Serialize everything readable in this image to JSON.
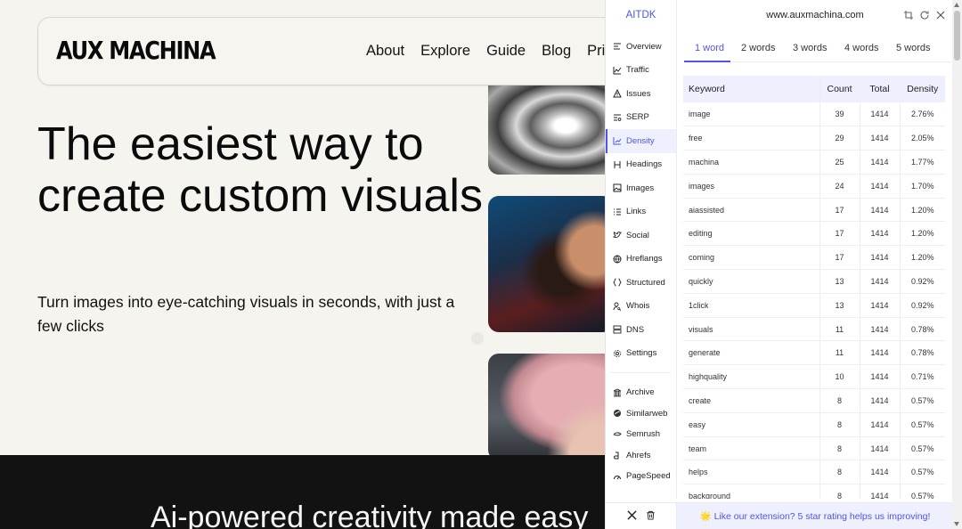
{
  "site": {
    "logo": "AUX MACHINA",
    "nav": [
      "About",
      "Explore",
      "Guide",
      "Blog",
      "Pricin"
    ],
    "hero_title": "The easiest way to create custom visuals",
    "hero_subtitle": "Turn images into eye-catching visuals in seconds, with just a few clicks",
    "band_text": "Ai-powered creativity made easy"
  },
  "extension": {
    "brand": "AITDK",
    "domain": "www.auxmachina.com",
    "accent": "#4f54e6",
    "sidebar": [
      {
        "label": "Overview",
        "icon": "overview-icon",
        "active": false
      },
      {
        "label": "Traffic",
        "icon": "traffic-icon",
        "active": false
      },
      {
        "label": "Issues",
        "icon": "warning-icon",
        "active": false
      },
      {
        "label": "SERP",
        "icon": "serp-icon",
        "active": false
      },
      {
        "label": "Density",
        "icon": "density-icon",
        "active": true
      },
      {
        "label": "Headings",
        "icon": "heading-icon",
        "active": false
      },
      {
        "label": "Images",
        "icon": "image-icon",
        "active": false
      },
      {
        "label": "Links",
        "icon": "links-icon",
        "active": false
      },
      {
        "label": "Social",
        "icon": "twitter-icon",
        "active": false
      },
      {
        "label": "Hreflangs",
        "icon": "globe-icon",
        "active": false
      },
      {
        "label": "Structured",
        "icon": "braces-icon",
        "active": false
      },
      {
        "label": "Whois",
        "icon": "user-search-icon",
        "active": false
      },
      {
        "label": "DNS",
        "icon": "server-icon",
        "active": false
      },
      {
        "label": "Settings",
        "icon": "gear-icon",
        "active": false
      }
    ],
    "external_links": [
      {
        "label": "Archive",
        "icon": "archive-icon"
      },
      {
        "label": "Similarweb",
        "icon": "similarweb-icon"
      },
      {
        "label": "Semrush",
        "icon": "semrush-icon"
      },
      {
        "label": "Ahrefs",
        "icon": "ahrefs-icon"
      },
      {
        "label": "PageSpeed",
        "icon": "pagespeed-icon"
      }
    ],
    "tabs": [
      "1 word",
      "2 words",
      "3 words",
      "4 words",
      "5 words"
    ],
    "active_tab": 0,
    "table": {
      "headers": [
        "Keyword",
        "Count",
        "Total",
        "Density"
      ],
      "rows": [
        [
          "image",
          "39",
          "1414",
          "2.76%"
        ],
        [
          "free",
          "29",
          "1414",
          "2.05%"
        ],
        [
          "machina",
          "25",
          "1414",
          "1.77%"
        ],
        [
          "images",
          "24",
          "1414",
          "1.70%"
        ],
        [
          "aiassisted",
          "17",
          "1414",
          "1.20%"
        ],
        [
          "editing",
          "17",
          "1414",
          "1.20%"
        ],
        [
          "coming",
          "17",
          "1414",
          "1.20%"
        ],
        [
          "quickly",
          "13",
          "1414",
          "0.92%"
        ],
        [
          "1click",
          "13",
          "1414",
          "0.92%"
        ],
        [
          "visuals",
          "11",
          "1414",
          "0.78%"
        ],
        [
          "generate",
          "11",
          "1414",
          "0.78%"
        ],
        [
          "highquality",
          "10",
          "1414",
          "0.71%"
        ],
        [
          "create",
          "8",
          "1414",
          "0.57%"
        ],
        [
          "easy",
          "8",
          "1414",
          "0.57%"
        ],
        [
          "team",
          "8",
          "1414",
          "0.57%"
        ],
        [
          "helps",
          "8",
          "1414",
          "0.57%"
        ],
        [
          "background",
          "8",
          "1414",
          "0.57%"
        ]
      ]
    },
    "footer_message": "🌟 Like our extension? 5 star rating helps us improving!"
  }
}
